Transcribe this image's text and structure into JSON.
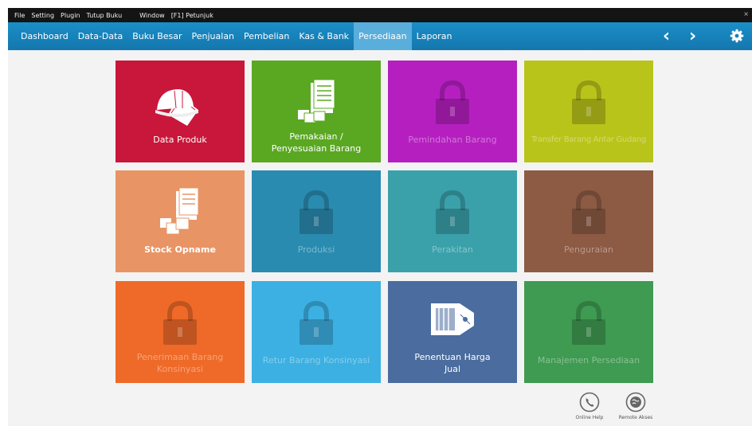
{
  "menubar": {
    "items": [
      "File",
      "Setting",
      "Plugin",
      "Tutup Buku",
      "Window",
      "[F1] Petunjuk"
    ],
    "close": "×"
  },
  "nav": {
    "tabs": [
      "Dashboard",
      "Data-Data",
      "Buku Besar",
      "Penjualan",
      "Pembelian",
      "Kas & Bank",
      "Persediaan",
      "Laporan"
    ],
    "active": "Persediaan",
    "prev": "‹",
    "next": "›"
  },
  "tiles": [
    {
      "label": "Data Produk",
      "color": "#c8173a",
      "icon": "helmet-icon",
      "locked": false
    },
    {
      "label": "Pemakaian / Penyesuaian Barang",
      "label_line1": "Pemakaian /",
      "label_line2": "Penyesuaian Barang",
      "color": "#5aa822",
      "icon": "documents-icon",
      "locked": false
    },
    {
      "label": "Pemindahan Barang",
      "color": "#b51fc0",
      "icon": "lock-icon",
      "locked": true
    },
    {
      "label": "Transfer Barang Antar Gudang",
      "color": "#b9c41a",
      "icon": "lock-icon",
      "locked": true
    },
    {
      "label": "Stock Opname",
      "color": "#e89465",
      "icon": "inventory-icon",
      "locked": false
    },
    {
      "label": "Produksi",
      "color": "#2a8bb0",
      "icon": "lock-icon",
      "locked": true
    },
    {
      "label": "Perakitan",
      "color": "#3aa1ab",
      "icon": "lock-icon",
      "locked": true
    },
    {
      "label": "Penguraian",
      "color": "#8d5a44",
      "icon": "lock-icon",
      "locked": true
    },
    {
      "label": "Penerimaan Barang Konsinyasi",
      "label_line1": "Penerimaan Barang",
      "label_line2": "Konsinyasi",
      "color": "#ef6a28",
      "icon": "lock-icon",
      "locked": true
    },
    {
      "label": "Retur Barang Konsinyasi",
      "color": "#3cb0e2",
      "icon": "lock-icon",
      "locked": true
    },
    {
      "label": "Penentuan Harga Jual",
      "label_line1": "Penentuan Harga",
      "label_line2": "Jual",
      "color": "#4a6c9e",
      "icon": "price-tag-icon",
      "locked": false
    },
    {
      "label": "Manajemen Persediaan",
      "color": "#3f9a52",
      "icon": "lock-icon",
      "locked": true
    }
  ],
  "help": {
    "online": "Online Help",
    "remote": "Remote Akses"
  }
}
